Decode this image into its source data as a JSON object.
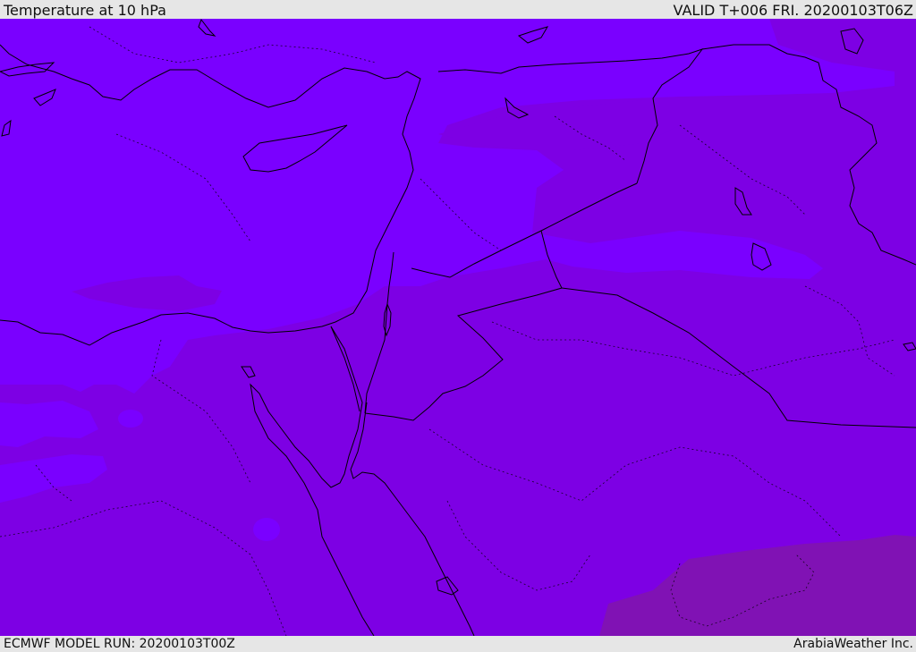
{
  "header": {
    "title": "Temperature at 10 hPa",
    "valid_time": "VALID T+006 FRI. 20200103T06Z"
  },
  "footer": {
    "model_run": "ECMWF MODEL RUN: 20200103T00Z",
    "provider": "ArabiaWeather Inc."
  },
  "colors": {
    "band_cold": "#7a00ff",
    "band_mid": "#7d00e4",
    "band_warm": "#8012b4",
    "coastline": "#000000",
    "background": "#e6e6e6"
  }
}
